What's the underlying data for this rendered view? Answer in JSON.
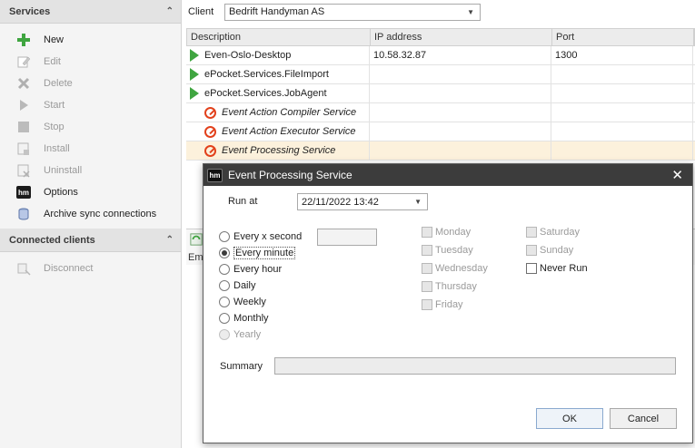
{
  "sidebar": {
    "services_header": "Services",
    "items": [
      {
        "label": "New",
        "icon": "plus-icon",
        "enabled": true
      },
      {
        "label": "Edit",
        "icon": "edit-icon",
        "enabled": false
      },
      {
        "label": "Delete",
        "icon": "delete-icon",
        "enabled": false
      },
      {
        "label": "Start",
        "icon": "play-icon",
        "enabled": false
      },
      {
        "label": "Stop",
        "icon": "stop-icon",
        "enabled": false
      },
      {
        "label": "Install",
        "icon": "install-icon",
        "enabled": false
      },
      {
        "label": "Uninstall",
        "icon": "uninstall-icon",
        "enabled": false
      },
      {
        "label": "Options",
        "icon": "hm-logo-icon",
        "enabled": true
      },
      {
        "label": "Archive sync connections",
        "icon": "archive-icon",
        "enabled": true
      }
    ],
    "clients_header": "Connected clients",
    "clients_items": [
      {
        "label": "Disconnect",
        "icon": "disconnect-icon",
        "enabled": false
      }
    ],
    "hm_badge": "hm"
  },
  "client": {
    "label": "Client",
    "value": "Bedrift Handyman AS"
  },
  "grid": {
    "columns": [
      "Description",
      "IP address",
      "Port"
    ],
    "rows": [
      {
        "status": "running",
        "description": "Even-Oslo-Desktop",
        "ip": "10.58.32.87",
        "port": "1300"
      },
      {
        "status": "running",
        "description": "ePocket.Services.FileImport",
        "ip": "",
        "port": ""
      },
      {
        "status": "running",
        "description": "ePocket.Services.JobAgent",
        "ip": "",
        "port": ""
      },
      {
        "status": "stopped",
        "description": "Event Action Compiler Service",
        "ip": "",
        "port": ""
      },
      {
        "status": "stopped",
        "description": "Event Action Executor Service",
        "ip": "",
        "port": ""
      },
      {
        "status": "stopped",
        "description": "Event Processing Service",
        "ip": "",
        "port": "",
        "selected": true
      }
    ]
  },
  "bottom_tab_label": "Em",
  "dialog": {
    "title": "Event Processing Service",
    "close": "✕",
    "run_at_label": "Run at",
    "run_at_value": "22/11/2022 13:42",
    "frequency": [
      {
        "label": "Every x second",
        "checked": false,
        "enabled": true
      },
      {
        "label": "Every minute",
        "checked": true,
        "enabled": true
      },
      {
        "label": "Every hour",
        "checked": false,
        "enabled": true
      },
      {
        "label": "Daily",
        "checked": false,
        "enabled": true
      },
      {
        "label": "Weekly",
        "checked": false,
        "enabled": true
      },
      {
        "label": "Monthly",
        "checked": false,
        "enabled": true
      },
      {
        "label": "Yearly",
        "checked": false,
        "enabled": false
      }
    ],
    "x_second_value": "",
    "days_col1": [
      "Monday",
      "Tuesday",
      "Wednesday",
      "Thursday",
      "Friday"
    ],
    "days_col2": [
      "Saturday",
      "Sunday"
    ],
    "never_run_label": "Never Run",
    "summary_label": "Summary",
    "summary_value": "",
    "ok_label": "OK",
    "cancel_label": "Cancel"
  },
  "colors": {
    "accent_play": "#3fa540",
    "stop_red": "#e2411c",
    "selected_row": "#fcf1dc",
    "dialog_title": "#3c3c3c"
  }
}
